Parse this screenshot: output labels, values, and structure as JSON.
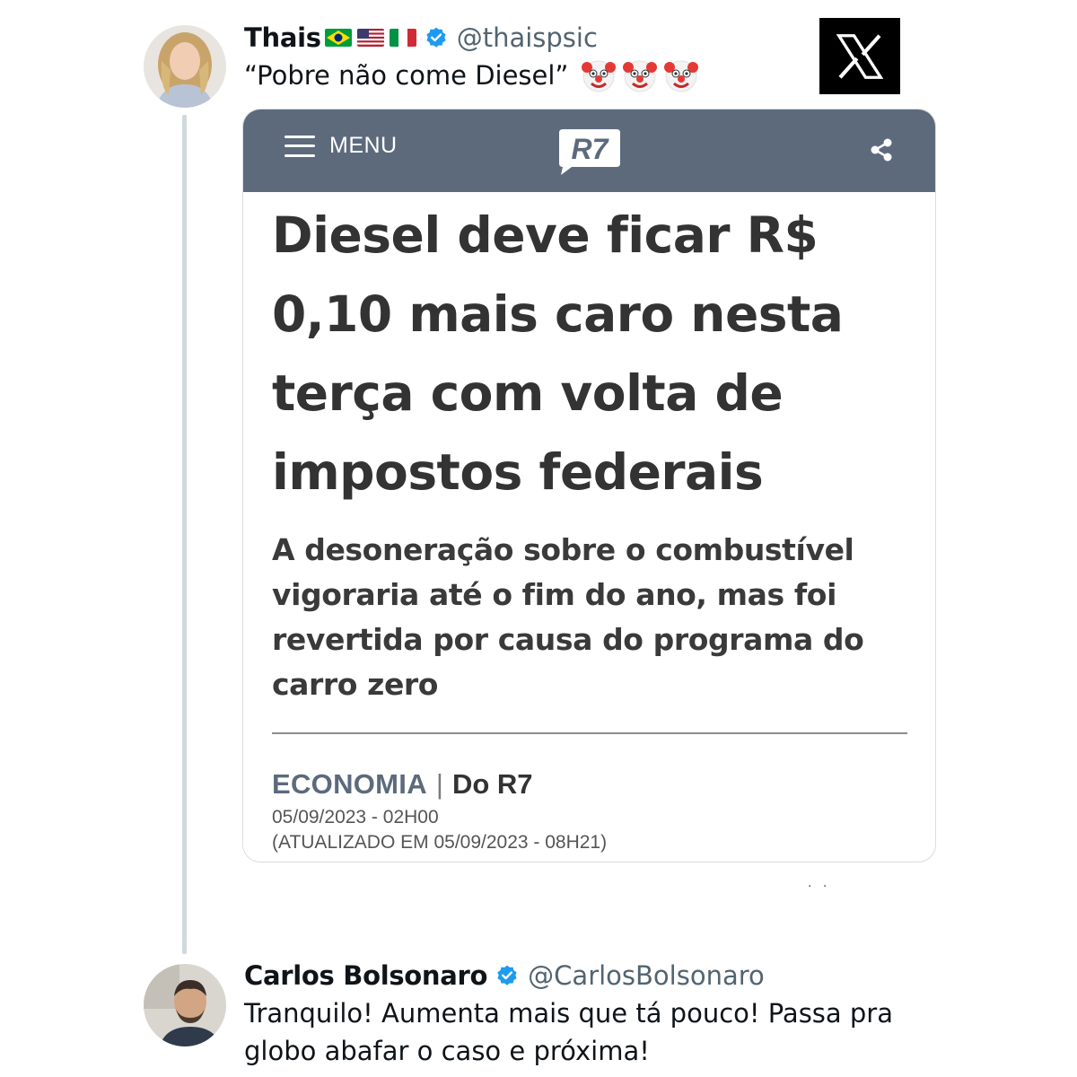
{
  "tweet1": {
    "name": "Thais",
    "flags": [
      "brazil-flag",
      "usa-flag",
      "italy-flag"
    ],
    "verified": true,
    "handle": "@thaispsic",
    "text": "“Pobre não come Diesel”",
    "emoji": [
      "clown-face",
      "clown-face",
      "clown-face"
    ]
  },
  "card": {
    "menu_label": "MENU",
    "logo_text": "R7",
    "headline": "Diesel deve ficar R$ 0,10 mais caro nesta terça com volta de impostos federais",
    "subtitle": "A desoneração sobre o combustível vigoraria até o fim do ano, mas foi revertida por causa do programa do carro zero",
    "section": "ECONOMIA",
    "separator": "|",
    "source": "Do R7",
    "published": "05/09/2023 - 02H00",
    "updated": "(ATUALIZADO EM 05/09/2023 - 08H21)"
  },
  "tweet2": {
    "name": "Carlos Bolsonaro",
    "verified": true,
    "handle": "@CarlosBolsonaro",
    "text": "Tranquilo! Aumenta mais que tá pouco! Passa pra globo abafar o caso e próxima!"
  },
  "colors": {
    "r7_bar": "#5c6a7c",
    "verified_blue": "#1d9bf0",
    "handle_gray": "#536471",
    "thread_line": "#cfd9de"
  },
  "icons": [
    "x-logo-icon",
    "verified-icon",
    "hamburger-icon",
    "share-icon",
    "r7-logo"
  ]
}
